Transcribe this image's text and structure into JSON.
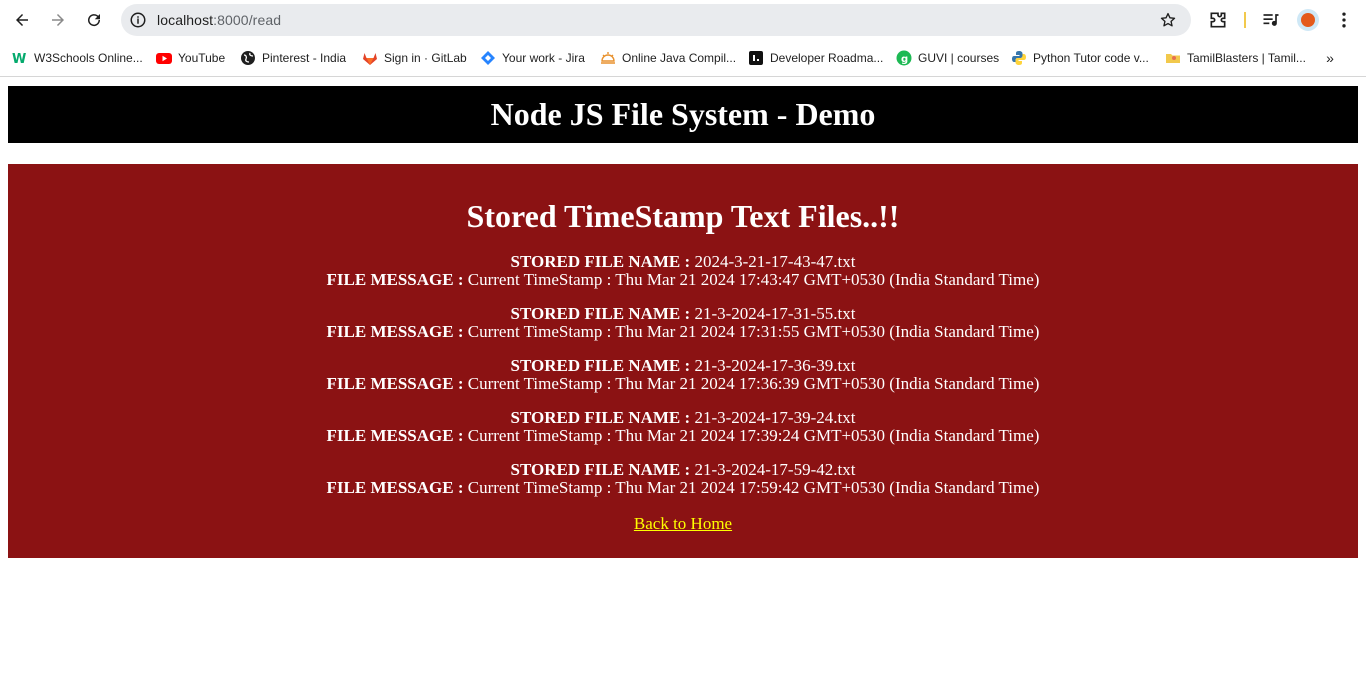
{
  "browser": {
    "url_host": "localhost",
    "url_path": ":8000/read",
    "bookmarks": [
      {
        "label": "W3Schools Online...",
        "icon": "w3schools-icon"
      },
      {
        "label": "YouTube",
        "icon": "youtube-icon"
      },
      {
        "label": "Pinterest - India",
        "icon": "globe-icon"
      },
      {
        "label": "Sign in · GitLab",
        "icon": "gitlab-icon"
      },
      {
        "label": "Your work - Jira",
        "icon": "jira-icon"
      },
      {
        "label": "Online Java Compil...",
        "icon": "sun-icon"
      },
      {
        "label": "Developer Roadma...",
        "icon": "roadmap-icon"
      },
      {
        "label": "GUVI | courses",
        "icon": "guvi-icon"
      },
      {
        "label": "Python Tutor code v...",
        "icon": "python-icon"
      },
      {
        "label": "TamilBlasters | Tamil...",
        "icon": "folder-icon"
      }
    ],
    "more_label": "»"
  },
  "header": {
    "title": "Node JS File System - Demo"
  },
  "main": {
    "heading": "Stored TimeStamp Text Files..!!",
    "name_label": "STORED FILE NAME :",
    "message_label": "FILE MESSAGE :",
    "files": [
      {
        "name": "2024-3-21-17-43-47.txt",
        "message": "Current TimeStamp : Thu Mar 21 2024 17:43:47 GMT+0530 (India Standard Time)"
      },
      {
        "name": "21-3-2024-17-31-55.txt",
        "message": "Current TimeStamp : Thu Mar 21 2024 17:31:55 GMT+0530 (India Standard Time)"
      },
      {
        "name": "21-3-2024-17-36-39.txt",
        "message": "Current TimeStamp : Thu Mar 21 2024 17:36:39 GMT+0530 (India Standard Time)"
      },
      {
        "name": "21-3-2024-17-39-24.txt",
        "message": "Current TimeStamp : Thu Mar 21 2024 17:39:24 GMT+0530 (India Standard Time)"
      },
      {
        "name": "21-3-2024-17-59-42.txt",
        "message": "Current TimeStamp : Thu Mar 21 2024 17:59:42 GMT+0530 (India Standard Time)"
      }
    ],
    "back_link": "Back to Home"
  },
  "colors": {
    "header_bg": "#000000",
    "panel_bg": "#8b1213",
    "link": "#ffff00"
  }
}
